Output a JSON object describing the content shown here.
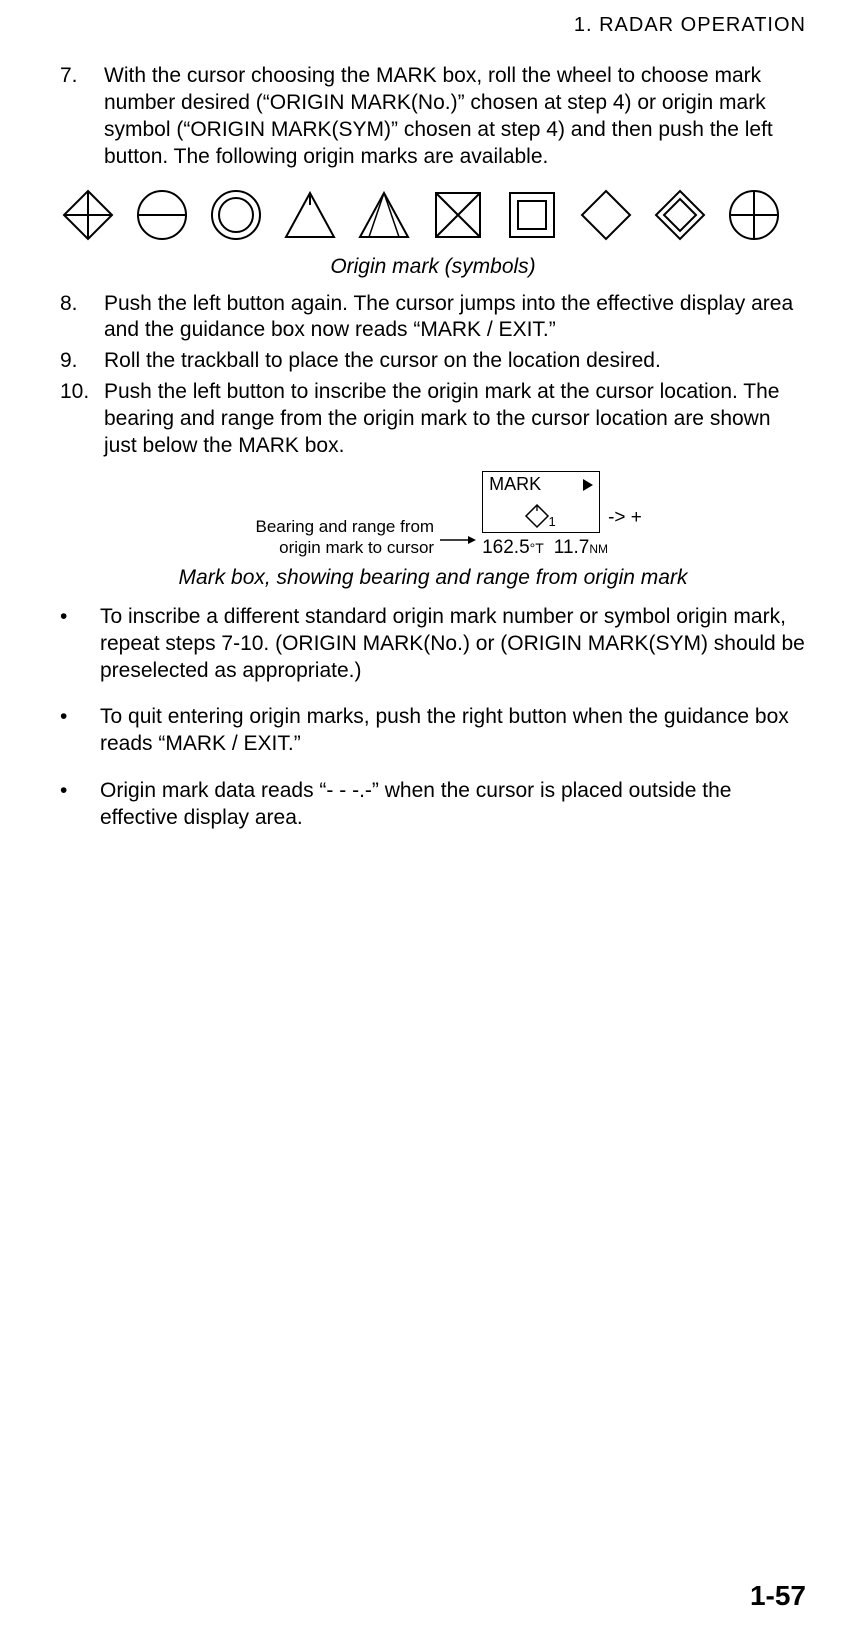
{
  "header": "1.  RADAR  OPERATION",
  "steps": {
    "n7": "7.",
    "t7": "With the cursor choosing the MARK box, roll the wheel to choose mark number desired (“ORIGIN MARK(No.)” chosen at step 4) or origin mark symbol (“ORIGIN MARK(SYM)” chosen at step 4) and then push the left button. The following origin marks are available.",
    "n8": "8.",
    "t8": "Push the left button again. The cursor jumps into the effective display area and the guidance box now reads “MARK / EXIT.”",
    "n9": "9.",
    "t9": "Roll the trackball to place the cursor on the location desired.",
    "n10": "10.",
    "t10": "Push the left button to inscribe the origin mark at the cursor location. The bearing and range from the origin mark to the cursor location are shown just below the MARK box."
  },
  "caption1": "Origin mark (symbols)",
  "caption2": "Mark box, showing bearing and range from origin mark",
  "markbox": {
    "title": "MARK",
    "sub": "1",
    "right": "-> +",
    "brg": "162.5",
    "brgUnit": "°T",
    "rng": "11.7",
    "rngUnit": "NM",
    "label1": "Bearing and range from",
    "label2": "origin mark to cursor"
  },
  "bullets": {
    "b1": "To inscribe a different standard origin mark number or symbol origin mark, repeat steps 7-10. (ORIGIN MARK(No.) or (ORIGIN MARK(SYM) should be preselected as appropriate.)",
    "b2": "To quit entering origin marks, push the right button when the guidance box reads “MARK / EXIT.”",
    "b3": "Origin mark data reads “- - -.-” when the cursor is placed outside the effective display area."
  },
  "pageNum": "1-57",
  "bulletGlyph": "•"
}
